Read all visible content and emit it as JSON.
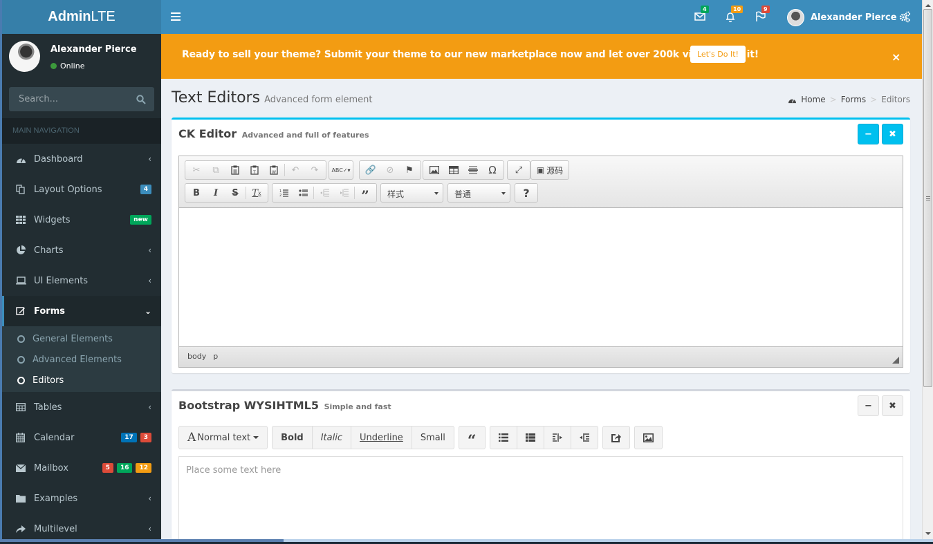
{
  "brand": {
    "bold": "Admin",
    "light": "LTE"
  },
  "navbar": {
    "messages": {
      "icon": "envelope-icon",
      "count": "4",
      "color": "#00a65a"
    },
    "notifications": {
      "icon": "bell-icon",
      "count": "10",
      "color": "#f39c12"
    },
    "tasks": {
      "icon": "flag-icon",
      "count": "9",
      "color": "#dd4b39"
    },
    "user_name": "Alexander Pierce",
    "settings_icon": "gears-icon"
  },
  "sidebar": {
    "user": {
      "name": "Alexander Pierce",
      "status": "Online"
    },
    "search": {
      "placeholder": "Search..."
    },
    "header": "MAIN NAVIGATION",
    "items": [
      {
        "label": "Dashboard",
        "icon": "dashboard-icon",
        "right": "chevron-left"
      },
      {
        "label": "Layout Options",
        "icon": "files-icon",
        "badges": [
          {
            "text": "4",
            "color": "#3c8dbc"
          }
        ]
      },
      {
        "label": "Widgets",
        "icon": "grid-icon",
        "badges": [
          {
            "text": "new",
            "color": "#00a65a"
          }
        ]
      },
      {
        "label": "Charts",
        "icon": "pie-chart-icon",
        "right": "chevron-left"
      },
      {
        "label": "UI Elements",
        "icon": "laptop-icon",
        "right": "chevron-left"
      },
      {
        "label": "Forms",
        "icon": "edit-icon",
        "right": "chevron-down",
        "active": true,
        "children": [
          {
            "label": "General Elements"
          },
          {
            "label": "Advanced Elements"
          },
          {
            "label": "Editors",
            "active": true
          }
        ]
      },
      {
        "label": "Tables",
        "icon": "table-icon",
        "right": "chevron-left"
      },
      {
        "label": "Calendar",
        "icon": "calendar-icon",
        "badges": [
          {
            "text": "17",
            "color": "#0073b7"
          },
          {
            "text": "3",
            "color": "#dd4b39"
          }
        ]
      },
      {
        "label": "Mailbox",
        "icon": "envelope-icon",
        "badges": [
          {
            "text": "5",
            "color": "#dd4b39"
          },
          {
            "text": "16",
            "color": "#00a65a"
          },
          {
            "text": "12",
            "color": "#f39c12"
          }
        ]
      },
      {
        "label": "Examples",
        "icon": "folder-icon",
        "right": "chevron-left"
      },
      {
        "label": "Multilevel",
        "icon": "share-icon",
        "right": "chevron-left"
      }
    ]
  },
  "callout": {
    "text": "Ready to sell your theme? Submit your theme to our new marketplace now and let over 200k visitors see it!",
    "button": "Let's Do It!",
    "close": "×",
    "color": "#f39c12"
  },
  "page": {
    "title": "Text Editors",
    "subtitle": "Advanced form element",
    "breadcrumb": [
      "Home",
      "Forms",
      "Editors"
    ]
  },
  "ckeditor": {
    "title": "CK Editor",
    "subtitle": "Advanced and full of features",
    "toolbar_row1": [
      [
        "Cut",
        "Copy",
        "Paste",
        "Paste as plain text",
        "Paste from Word",
        "|",
        "Undo",
        "Redo"
      ],
      [
        "Spell Check"
      ],
      [
        "Link",
        "Unlink",
        "Anchor"
      ],
      [
        "Image",
        "Table",
        "Horizontal Line",
        "Special Character"
      ],
      [
        "Maximize"
      ],
      [
        "Source"
      ]
    ],
    "source_label": "源码",
    "toolbar_row2": [
      [
        "Bold",
        "Italic",
        "Strike",
        "|",
        "Remove Format"
      ],
      [
        "Numbered List",
        "Bulleted List",
        "|",
        "Decrease Indent",
        "Increase Indent",
        "|",
        "Block Quote"
      ]
    ],
    "styles_combo": "样式",
    "format_combo": "普通",
    "help": "?",
    "path": [
      "body",
      "p"
    ],
    "accent": "#00c0ef"
  },
  "wysihtml5": {
    "title": "Bootstrap WYSIHTML5",
    "subtitle": "Simple and fast",
    "font_style": "Normal text",
    "format_buttons": [
      "Bold",
      "Italic",
      "Underline",
      "Small"
    ],
    "placeholder": "Place some text here"
  }
}
